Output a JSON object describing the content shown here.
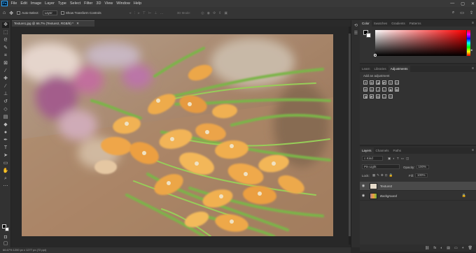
{
  "menu": {
    "logo": "Ps",
    "items": [
      "File",
      "Edit",
      "Image",
      "Layer",
      "Type",
      "Select",
      "Filter",
      "3D",
      "View",
      "Window",
      "Help"
    ],
    "window_controls": [
      "—",
      "▢",
      "✕"
    ]
  },
  "options": {
    "auto_select_label": "Auto-Select:",
    "auto_select_value": "Layer",
    "transform_label": "Show Transform Controls",
    "mode_3d": "3D Mode:"
  },
  "document": {
    "tab_title": "Texture1.jpg @ 66.7% (Texture2, RGB/8) *",
    "status": "66.67%    1200 px x 1277 px (72 ppi)"
  },
  "panels": {
    "color_tabs": [
      "Color",
      "Swatches",
      "Gradients",
      "Patterns"
    ],
    "adj_tabs": [
      "Learn",
      "Libraries",
      "Adjustments"
    ],
    "adjustments_hint": "Add an adjustment",
    "adj_row1": [
      "☀",
      "▥",
      "◪",
      "◩",
      "▽",
      "⊡"
    ],
    "adj_row2": [
      "⊞",
      "⚖",
      "◑",
      "◐",
      "◉",
      "▦"
    ],
    "adj_row3": [
      "◨",
      "◩",
      "▨",
      "▭",
      "◫"
    ],
    "layers_tabs": [
      "Layers",
      "Channels",
      "Paths"
    ],
    "kind": "Kind",
    "blend_mode": "Pin Light",
    "opacity_label": "Opacity:",
    "opacity_value": "100%",
    "lock_label": "Lock:",
    "fill_label": "Fill:",
    "fill_value": "100%",
    "layers": [
      {
        "name": "Texture2",
        "selected": true
      },
      {
        "name": "Background",
        "selected": false
      }
    ],
    "footer_icons": [
      "⛓",
      "fx",
      "◐",
      "▤",
      "▭",
      "+",
      "🗑"
    ]
  },
  "colors": {
    "accent": "#31a8ff",
    "foreground": "#000000",
    "background": "#ffffff"
  }
}
